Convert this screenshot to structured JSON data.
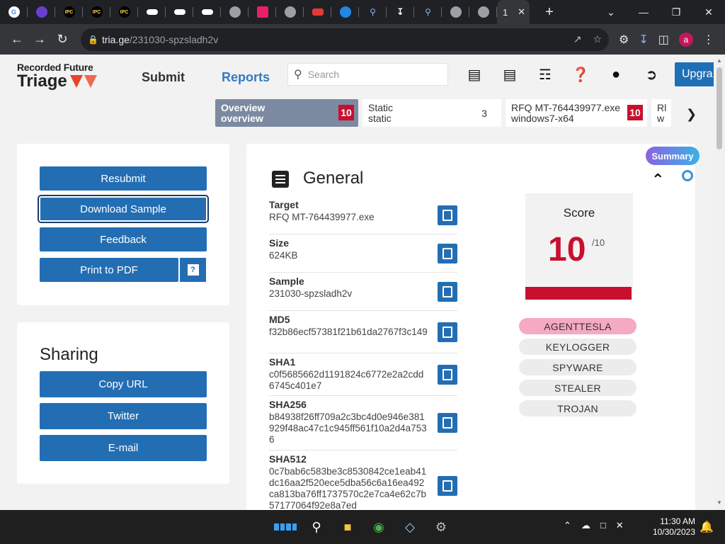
{
  "browser": {
    "tab_icons": [
      "google-icon",
      "game-icon",
      "ipc-games-icon",
      "ipc-games-icon",
      "ipc-games-icon",
      "pill-icon",
      "pill-icon",
      "pill-icon",
      "globe-icon",
      "bookmark-icon",
      "globe-icon",
      "flag-icon",
      "search-lens-icon",
      "search-icon",
      "download-icon",
      "search-icon",
      "globe-icon",
      "globe-icon"
    ],
    "active_tab_label": "1",
    "url_host": "tria.ge",
    "url_path": "/231030-spzsladh2v"
  },
  "header": {
    "logo_top": "Recorded Future",
    "logo_brand": "Triage",
    "nav_submit": "Submit",
    "nav_reports": "Reports",
    "search_placeholder": "Search",
    "upgrade_label": "Upgra"
  },
  "task_tabs": [
    {
      "line1": "Overview",
      "line2": "overview",
      "score": "10"
    },
    {
      "line1": "Static",
      "line2": "static",
      "score": "3"
    },
    {
      "line1": "RFQ MT-764439977.exe",
      "line2": "windows7-x64",
      "score": "10"
    },
    {
      "line1": "Rl",
      "line2": "w",
      "score": ""
    }
  ],
  "actions": {
    "resubmit": "Resubmit",
    "download": "Download Sample",
    "feedback": "Feedback",
    "print": "Print to PDF",
    "help": "?"
  },
  "sharing": {
    "title": "Sharing",
    "copy_url": "Copy URL",
    "twitter": "Twitter",
    "email": "E-mail"
  },
  "general": {
    "title": "General",
    "fields": [
      {
        "label": "Target",
        "value": "RFQ MT-764439977.exe"
      },
      {
        "label": "Size",
        "value": "624KB"
      },
      {
        "label": "Sample",
        "value": "231030-spzsladh2v"
      },
      {
        "label": "MD5",
        "value": "f32b86ecf57381f21b61da2767f3c149"
      },
      {
        "label": "SHA1",
        "value": "c0f5685662d1191824c6772e2a2cdd6745c401e7"
      },
      {
        "label": "SHA256",
        "value": "b84938f26ff709a2c3bc4d0e946e381929f48ac47c1c945ff561f10a2d4a7536"
      },
      {
        "label": "SHA512",
        "value": "0c7bab6c583be3c8530842ce1eab41dc16aa2f520ece5dba56c6a16ea492ca813ba76ff1737570c2e7ca4e62c7b57177064f92e8a7ed"
      }
    ],
    "score_label": "Score",
    "score_value": "10",
    "score_max": "/10",
    "tags": [
      "AGENTTESLA",
      "KEYLOGGER",
      "SPYWARE",
      "STEALER",
      "TROJAN"
    ],
    "summary_label": "Summary"
  },
  "taskbar": {
    "time": "11:30 AM",
    "date": "10/30/2023"
  },
  "colors": {
    "accent_blue": "#236eb3",
    "danger_red": "#c8102e",
    "reports_blue": "#3579c2"
  }
}
